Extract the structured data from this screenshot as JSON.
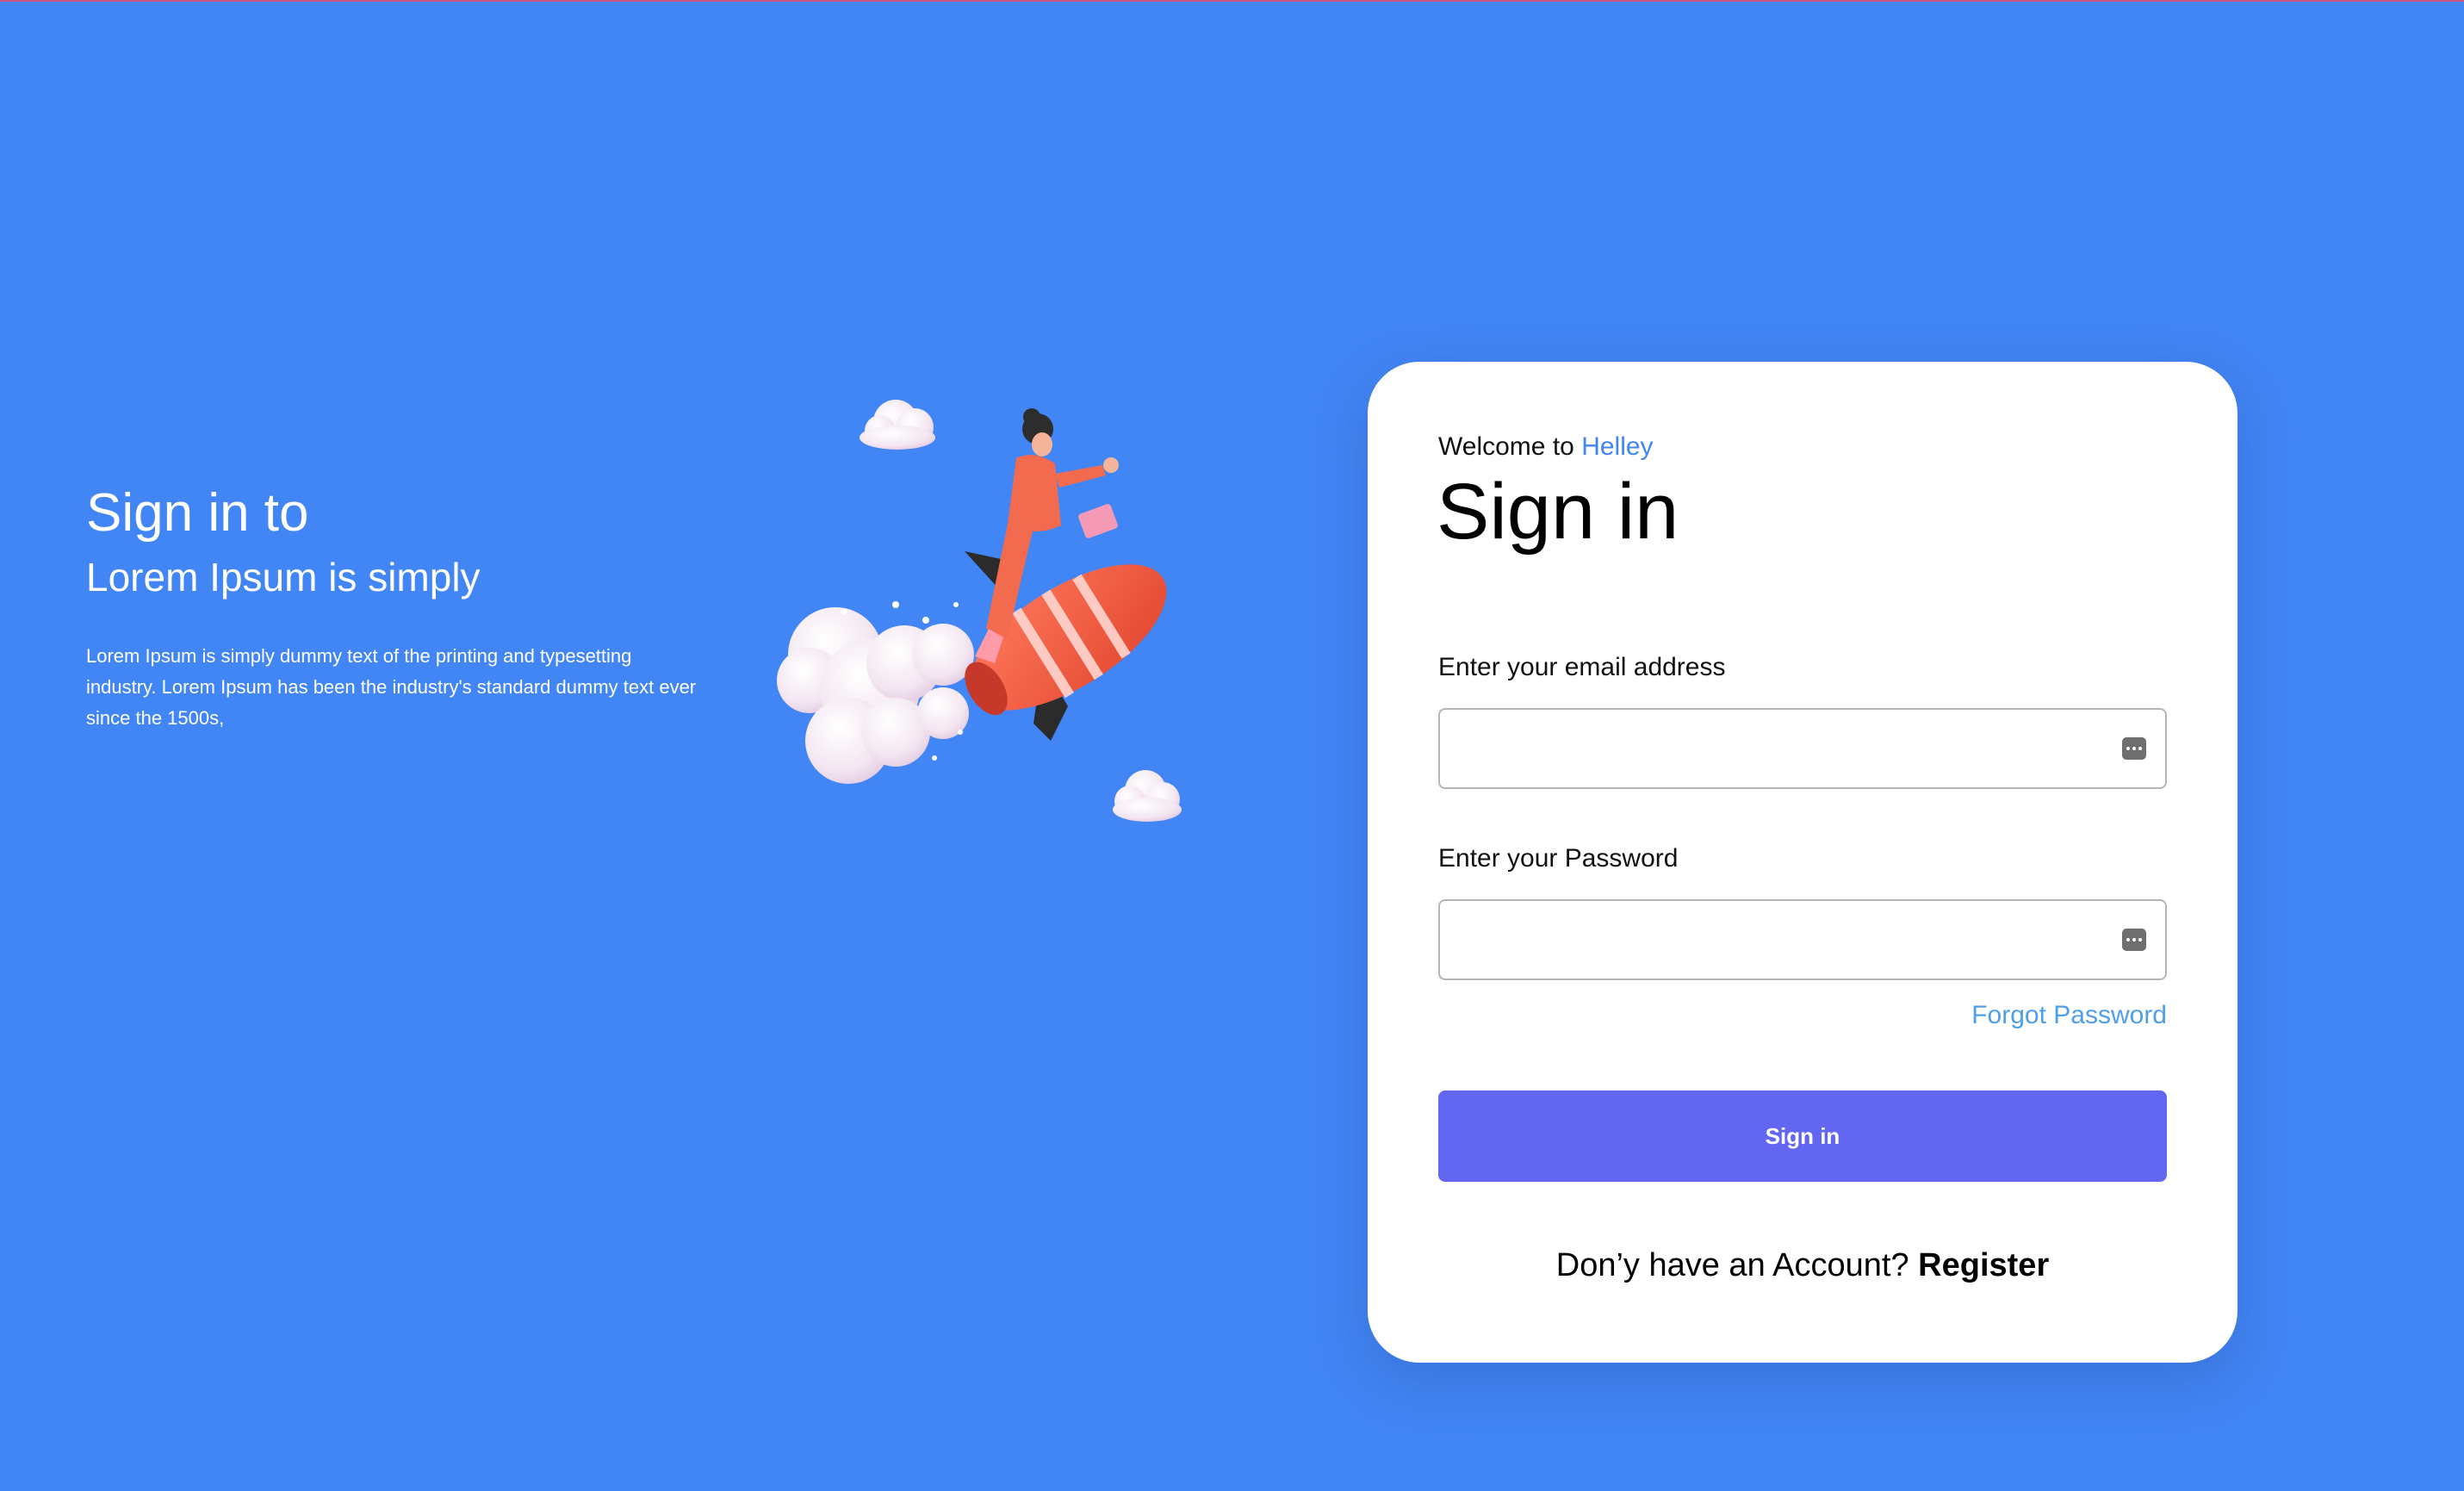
{
  "hero": {
    "title": "Sign in to",
    "subtitle": "Lorem Ipsum is simply",
    "body": "Lorem Ipsum is simply dummy text of the printing and typesetting industry. Lorem Ipsum has been the industry's standard dummy text ever since the 1500s,"
  },
  "card": {
    "welcome_prefix": "Welcome to",
    "brand": "Helley",
    "title": "Sign in",
    "email_label": "Enter your email address",
    "email_value": "",
    "password_label": "Enter your Password",
    "password_value": "",
    "forgot_password": "Forgot Password",
    "submit_label": "Sign in",
    "register_prompt": "Don’y have an Account?",
    "register_link": "Register"
  },
  "colors": {
    "background": "#4285f4",
    "brand": "#4285f4",
    "button": "#6366f1",
    "link": "#4f9ee8",
    "card": "#ffffff"
  },
  "icons": {
    "email_field": "password-manager-icon",
    "password_field": "password-manager-icon"
  }
}
